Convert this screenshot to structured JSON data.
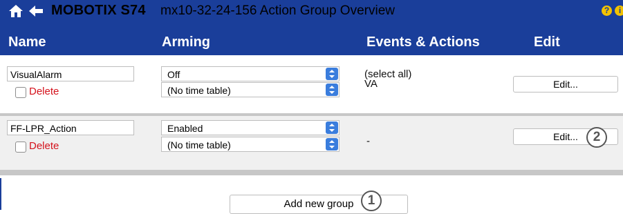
{
  "title": {
    "brand": "MOBOTIX S74",
    "text": "mx10-32-24-156 Action Group Overview"
  },
  "icons": {
    "home": "home-icon",
    "back": "back-arrow-icon",
    "help": "help-icon",
    "info": "info-icon"
  },
  "header": {
    "name": "Name",
    "arming": "Arming",
    "events": "Events & Actions",
    "edit": "Edit"
  },
  "groups": [
    {
      "name": "VisualAlarm",
      "delete_label": "Delete",
      "arming": "Off",
      "time_table": "(No time table)",
      "events": [
        "(select all)",
        "VA"
      ],
      "edit_label": "Edit..."
    },
    {
      "name": "FF-LPR_Action",
      "delete_label": "Delete",
      "arming": "Enabled",
      "time_table": "(No time table)",
      "events_text": "-",
      "edit_label": "Edit...",
      "callout": "2"
    }
  ],
  "add_group": {
    "label": "Add new group",
    "callout": "1"
  },
  "colors": {
    "title_bar": "#1a3e9a",
    "delete_text": "#d4121c",
    "select_arrow": "#3a7ddd",
    "help_icon": "#f2c200"
  }
}
